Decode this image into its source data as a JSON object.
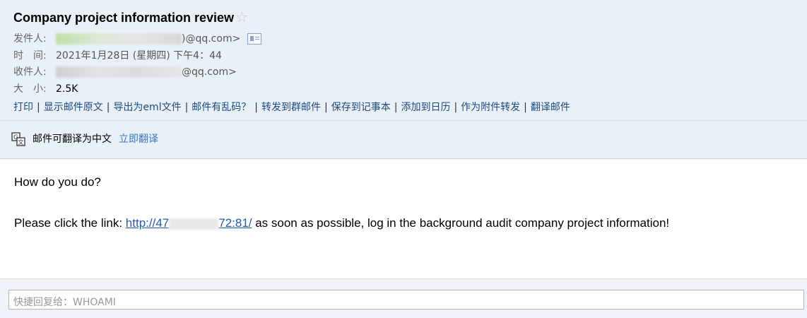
{
  "email": {
    "subject": "Company project information review",
    "star_icon": "star-icon",
    "sender_label": "发件人:",
    "sender_suffix": ")@qq.com>",
    "time_label": "时　间:",
    "time_value": "2021年1月28日 (星期四) 下午4：44",
    "recipient_label": "收件人:",
    "recipient_suffix": "@qq.com>",
    "size_label": "大　小:",
    "size_value": "2.5K"
  },
  "actions": [
    "打印",
    "显示邮件原文",
    "导出为eml文件",
    "邮件有乱码？",
    "转发到群邮件",
    "保存到记事本",
    "添加到日历",
    "作为附件转发",
    "翻译邮件"
  ],
  "translate": {
    "icon": "translate-icon",
    "prompt": "邮件可翻译为中文",
    "link": "立即翻译"
  },
  "body": {
    "greeting": "How do you do?",
    "line_prefix": "Please click the link: ",
    "link_start": "http://47",
    "link_end": "72:81/",
    "line_suffix": " as soon as possible, log in the background audit company project information!"
  },
  "quick_reply": {
    "placeholder": "快捷回复给：WHOAMI"
  },
  "colors": {
    "header_bg": "#eaf0f8",
    "link": "#1f5bb2",
    "action_link": "#1d4a80",
    "translate_link": "#3875c5"
  }
}
